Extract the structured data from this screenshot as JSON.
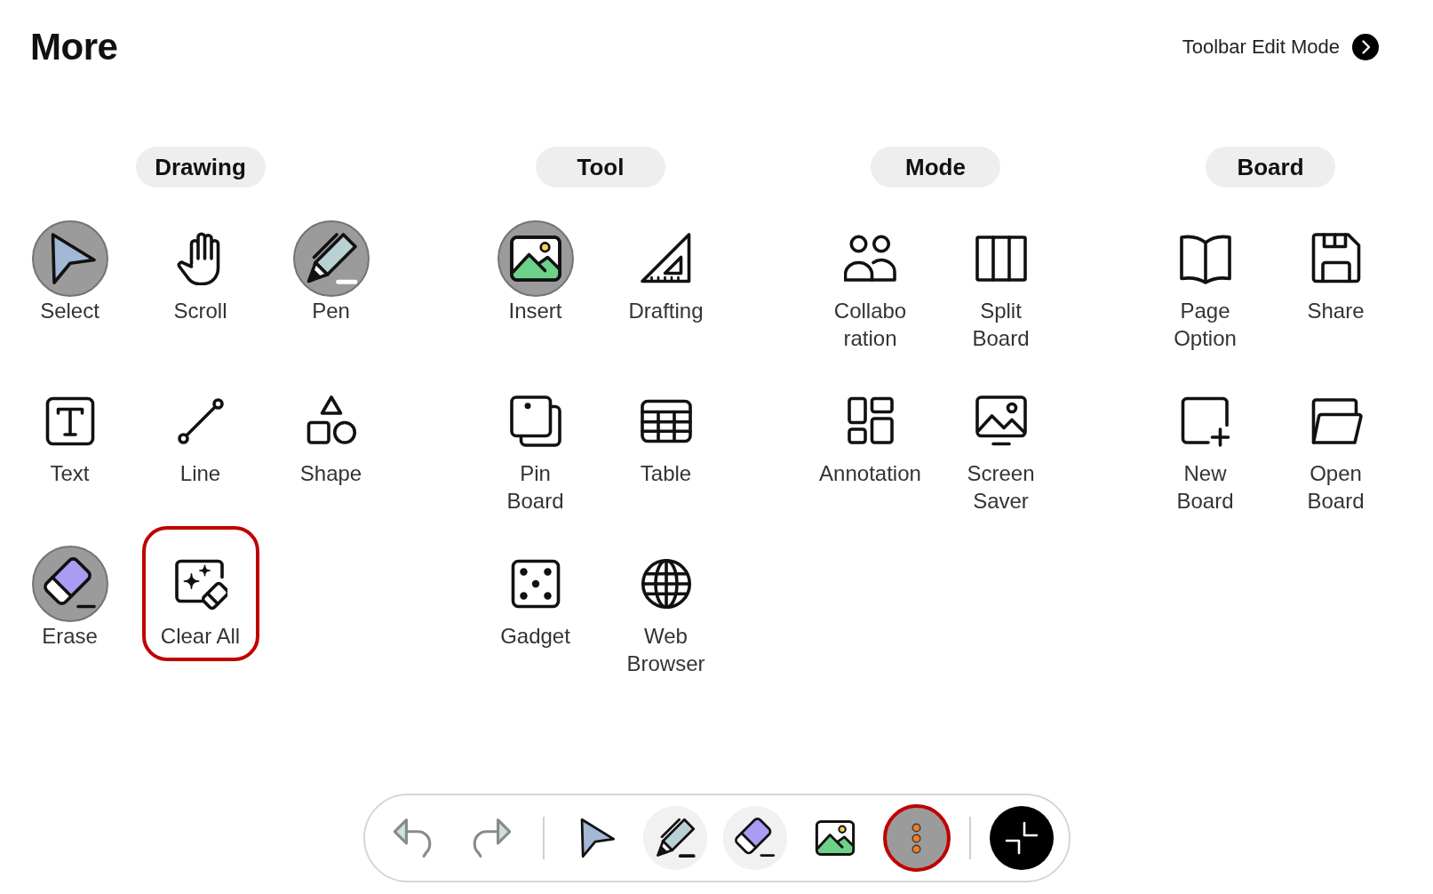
{
  "header": {
    "title": "More",
    "edit_mode_link": "Toolbar Edit Mode"
  },
  "sections": [
    {
      "title": "Drawing",
      "items": [
        {
          "kind": "select",
          "label": "Select",
          "selected": true,
          "highlighted": false
        },
        {
          "kind": "scroll",
          "label": "Scroll",
          "selected": false,
          "highlighted": false
        },
        {
          "kind": "pen",
          "label": "Pen",
          "selected": true,
          "highlighted": false
        },
        {
          "kind": "text",
          "label": "Text",
          "selected": false,
          "highlighted": false
        },
        {
          "kind": "line",
          "label": "Line",
          "selected": false,
          "highlighted": false
        },
        {
          "kind": "shape",
          "label": "Shape",
          "selected": false,
          "highlighted": false
        },
        {
          "kind": "erase",
          "label": "Erase",
          "selected": true,
          "highlighted": false
        },
        {
          "kind": "clear-all",
          "label": "Clear All",
          "selected": false,
          "highlighted": true
        }
      ]
    },
    {
      "title": "Tool",
      "items": [
        {
          "kind": "insert",
          "label": "Insert",
          "selected": true,
          "highlighted": false
        },
        {
          "kind": "drafting",
          "label": "Drafting",
          "selected": false,
          "highlighted": false
        },
        {
          "kind": "pin-board",
          "label": "Pin\nBoard",
          "selected": false,
          "highlighted": false
        },
        {
          "kind": "table",
          "label": "Table",
          "selected": false,
          "highlighted": false
        },
        {
          "kind": "gadget",
          "label": "Gadget",
          "selected": false,
          "highlighted": false
        },
        {
          "kind": "web-browser",
          "label": "Web\nBrowser",
          "selected": false,
          "highlighted": false
        }
      ]
    },
    {
      "title": "Mode",
      "items": [
        {
          "kind": "collaboration",
          "label": "Collabo\nration",
          "selected": false,
          "highlighted": false
        },
        {
          "kind": "split-board",
          "label": "Split\nBoard",
          "selected": false,
          "highlighted": false
        },
        {
          "kind": "annotation",
          "label": "Annotation",
          "selected": false,
          "highlighted": false
        },
        {
          "kind": "screen-saver",
          "label": "Screen\nSaver",
          "selected": false,
          "highlighted": false
        }
      ]
    },
    {
      "title": "Board",
      "items": [
        {
          "kind": "page-option",
          "label": "Page\nOption",
          "selected": false,
          "highlighted": false
        },
        {
          "kind": "share",
          "label": "Share",
          "selected": false,
          "highlighted": false
        },
        {
          "kind": "new-board",
          "label": "New\nBoard",
          "selected": false,
          "highlighted": false
        },
        {
          "kind": "open-board",
          "label": "Open\nBoard",
          "selected": false,
          "highlighted": false
        }
      ]
    }
  ],
  "toolbar": {
    "groups": [
      {
        "items": [
          {
            "kind": "undo",
            "selected": false,
            "tinted": false,
            "highlighted": false
          },
          {
            "kind": "redo",
            "selected": false,
            "tinted": false,
            "highlighted": false
          }
        ]
      },
      {
        "items": [
          {
            "kind": "select",
            "selected": false,
            "tinted": false,
            "highlighted": false
          },
          {
            "kind": "pen",
            "selected": false,
            "tinted": true,
            "highlighted": false
          },
          {
            "kind": "erase",
            "selected": false,
            "tinted": true,
            "highlighted": false
          },
          {
            "kind": "insert",
            "selected": false,
            "tinted": false,
            "highlighted": false
          },
          {
            "kind": "more",
            "selected": true,
            "tinted": false,
            "highlighted": true
          }
        ]
      },
      {
        "items": [
          {
            "kind": "collapse",
            "selected": false,
            "tinted": false,
            "highlighted": false
          }
        ]
      }
    ]
  }
}
